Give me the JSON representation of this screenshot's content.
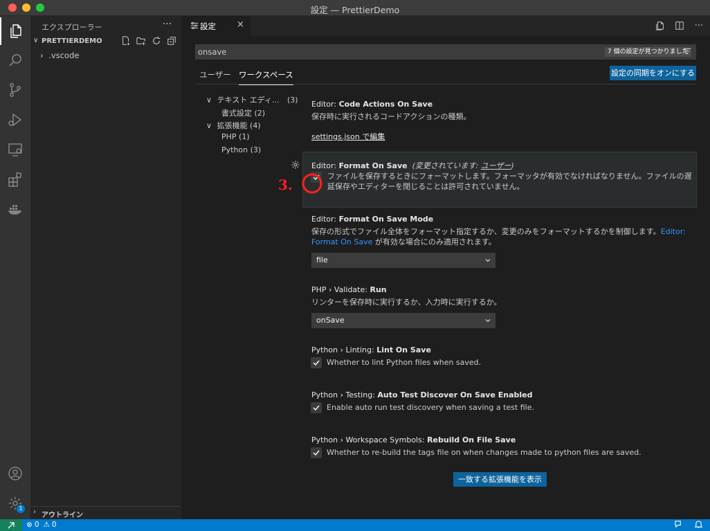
{
  "window": {
    "title": "設定 — PrettierDemo"
  },
  "sidebar": {
    "header": "エクスプローラー",
    "more": "···",
    "project": "PRETTIERDEMO",
    "tree": [
      ".vscode"
    ],
    "outline": "アウトライン"
  },
  "activity": {
    "settings_badge": "1"
  },
  "tab": {
    "label": "設定",
    "close": "×"
  },
  "search": {
    "value": "onsave",
    "count": "7 個の設定が見つかりました"
  },
  "scopes": {
    "user": "ユーザー",
    "workspace": "ワークスペース",
    "sync_button": "設定の同期をオンにする"
  },
  "toc": {
    "text_editor": "テキスト エディ...",
    "text_editor_count": "(3)",
    "formatting": "書式設定 (2)",
    "extensions": "拡張機能 (4)",
    "php": "PHP (1)",
    "python": "Python (3)"
  },
  "settings": {
    "code_actions": {
      "category": "Editor: ",
      "name": "Code Actions On Save",
      "desc": "保存時に実行されるコードアクションの種類。",
      "link": "settings.json で編集"
    },
    "format_on_save": {
      "category": "Editor: ",
      "name": "Format On Save",
      "modified_prefix": "(変更されています: ",
      "modified_scope": "ユーザー",
      "modified_suffix": ")",
      "desc": "ファイルを保存するときにフォーマットします。フォーマッタが有効でなければなりません。ファイルの遅延保存やエディターを閉じることは許可されていません。",
      "checked": true
    },
    "format_on_save_mode": {
      "category": "Editor: ",
      "name": "Format On Save Mode",
      "desc": "保存の形式でファイル全体をフォーマット指定するか、変更のみをフォーマットするかを制御します。",
      "desc_link": "Editor: Format On Save",
      "desc_tail": " が有効な場合にのみ適用されます。",
      "value": "file"
    },
    "php_validate": {
      "category": "PHP › Validate: ",
      "name": "Run",
      "desc": "リンターを保存時に実行するか、入力時に実行するか。",
      "value": "onSave"
    },
    "python_lint": {
      "category": "Python › Linting: ",
      "name": "Lint On Save",
      "desc": "Whether to lint Python files when saved.",
      "checked": true
    },
    "python_testing": {
      "category": "Python › Testing: ",
      "name": "Auto Test Discover On Save Enabled",
      "desc": "Enable auto run test discovery when saving a test file.",
      "checked": true
    },
    "python_workspace": {
      "category": "Python › Workspace Symbols: ",
      "name": "Rebuild On File Save",
      "desc": "Whether to re-build the tags file on when changes made to python files are saved.",
      "checked": true
    }
  },
  "ext_button": "一致する拡張機能を表示",
  "annotation": {
    "text": "3."
  },
  "status": {
    "errors": "0",
    "warnings": "0"
  },
  "colors": {
    "accent": "#007acc",
    "button": "#0e639c",
    "remote": "#16825d",
    "annotation": "#ff2020"
  }
}
